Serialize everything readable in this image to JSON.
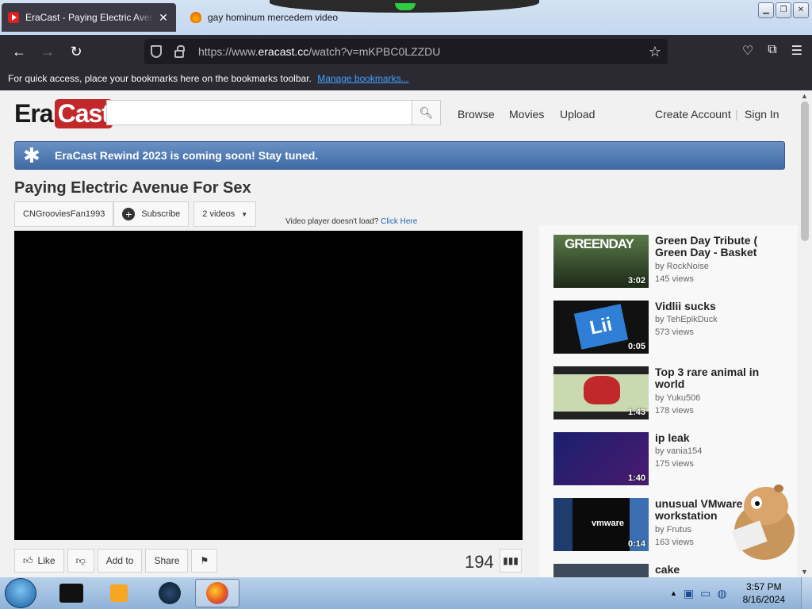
{
  "browser": {
    "tabs": [
      {
        "title": "EraCast - Paying Electric Avenue For Sex",
        "close": "✕"
      },
      {
        "title": "gay hominum mercedem video"
      }
    ],
    "url_prefix": "https://www.",
    "url_domain": "eracast.cc",
    "url_path": "/watch?v=mKPBC0LZZDU",
    "bookmarks_text": "For quick access, place your bookmarks here on the bookmarks toolbar.",
    "bookmarks_link": "Manage bookmarks..."
  },
  "site": {
    "logo_left": "Era",
    "logo_right": "Cast",
    "nav": [
      "Browse",
      "Movies",
      "Upload"
    ],
    "account": [
      "Create Account",
      "Sign In"
    ],
    "banner": "EraCast Rewind 2023 is coming soon! Stay tuned."
  },
  "video": {
    "title": "Paying Electric Avenue For Sex",
    "channel": "CNGrooviesFan1993",
    "subscribe": "Subscribe",
    "videos_count": "2 videos",
    "noload_text": "Video player doesn't load?",
    "noload_link": "Click Here",
    "like": "Like",
    "add_to": "Add to",
    "share": "Share",
    "views": "194"
  },
  "sidebar": [
    {
      "title": "Green Day Tribute ( Green Day - Basket",
      "by": "by RockNoise",
      "views": "145 views",
      "duration": "3:02",
      "thumb_text": "GREENDAY"
    },
    {
      "title": "Vidlii sucks",
      "by": "by TehEpikDuck",
      "views": "573 views",
      "duration": "0:05",
      "thumb_text": "Lii"
    },
    {
      "title": "Top 3 rare animal in world",
      "by": "by Yuku506",
      "views": "178 views",
      "duration": "1:43"
    },
    {
      "title": "ip leak",
      "by": "by vania154",
      "views": "175 views",
      "duration": "1:40"
    },
    {
      "title": "unusual VMware workstation",
      "by": "by Frutus",
      "views": "163 views",
      "duration": "0:14",
      "thumb_text": "vmware"
    },
    {
      "title": "cake"
    }
  ],
  "taskbar": {
    "time": "3:57 PM",
    "date": "8/16/2024"
  },
  "colors": {
    "accent_red": "#c0282a",
    "banner_blue": "#4a76ad",
    "link_blue": "#2366b3"
  }
}
